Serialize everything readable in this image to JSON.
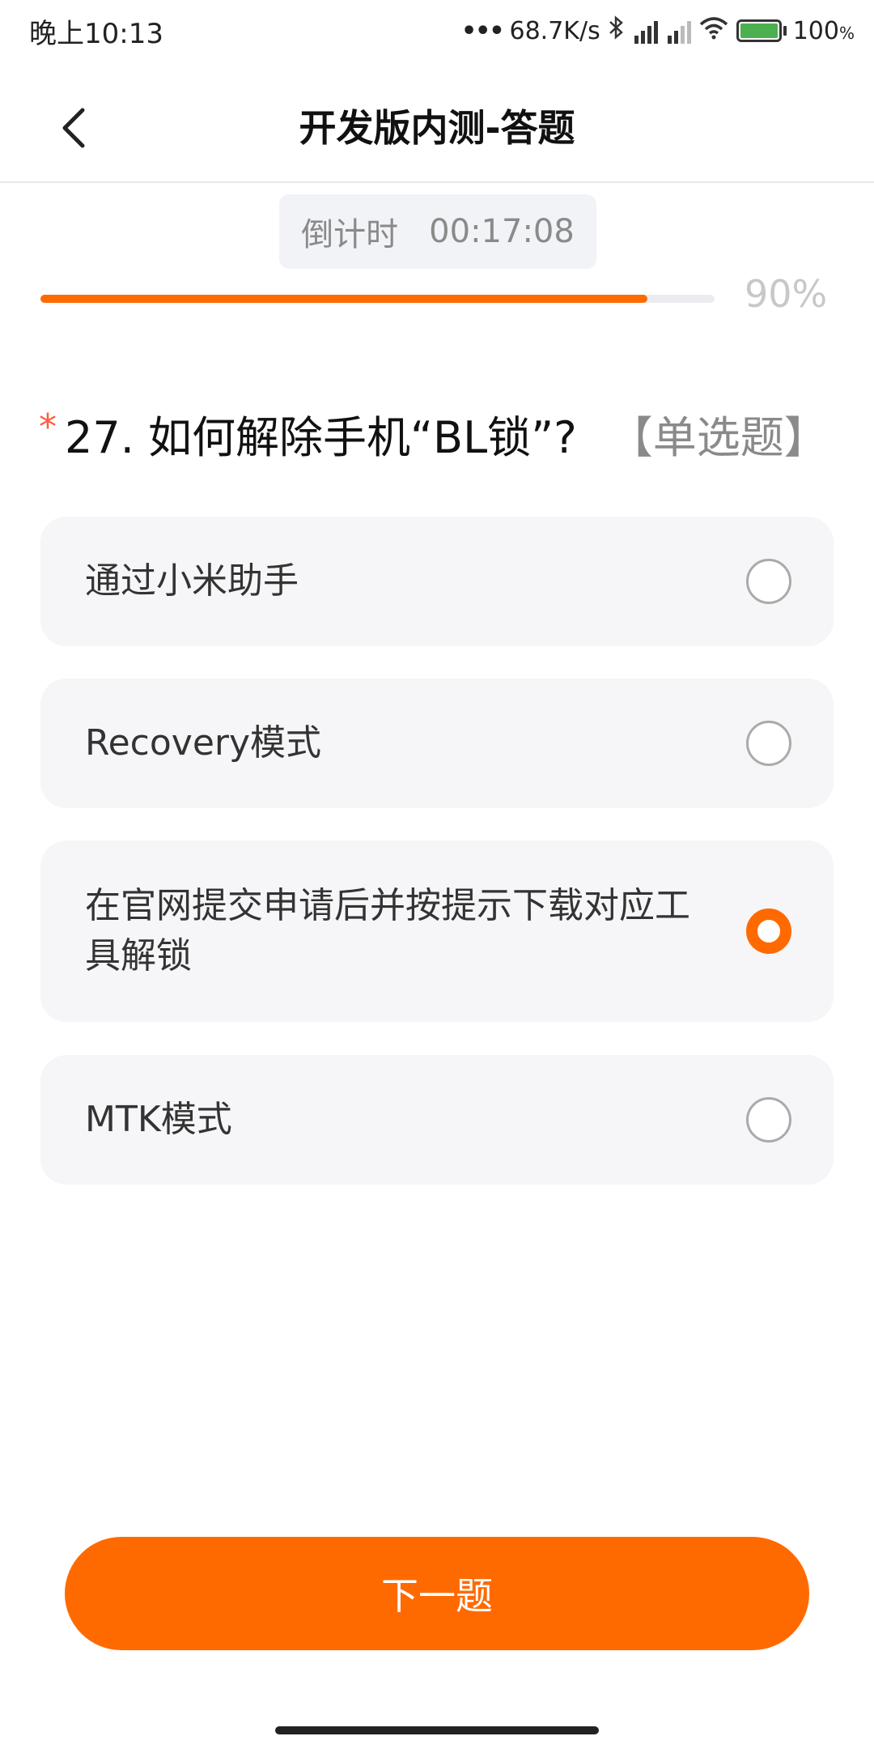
{
  "status_bar": {
    "time": "晚上10:13",
    "network_speed": "68.7K/s",
    "battery_percent": "100"
  },
  "header": {
    "title": "开发版内测-答题"
  },
  "countdown": {
    "label": "倒计时",
    "value": "00:17:08"
  },
  "progress": {
    "percent": 90,
    "label": "90%",
    "color": "#ff6a00"
  },
  "question": {
    "required_mark": "*",
    "text": "27. 如何解除手机“BL锁”?",
    "type": "【单选题】"
  },
  "options": [
    {
      "label": "通过小米助手",
      "selected": false
    },
    {
      "label": "Recovery模式",
      "selected": false
    },
    {
      "label": "在官网提交申请后并按提示下载对应工具解锁",
      "selected": true
    },
    {
      "label": "MTK模式",
      "selected": false
    }
  ],
  "next_button": {
    "label": "下一题"
  },
  "colors": {
    "accent": "#ff6a00",
    "option_bg": "#f6f6f8",
    "required": "#ff5a3c"
  }
}
